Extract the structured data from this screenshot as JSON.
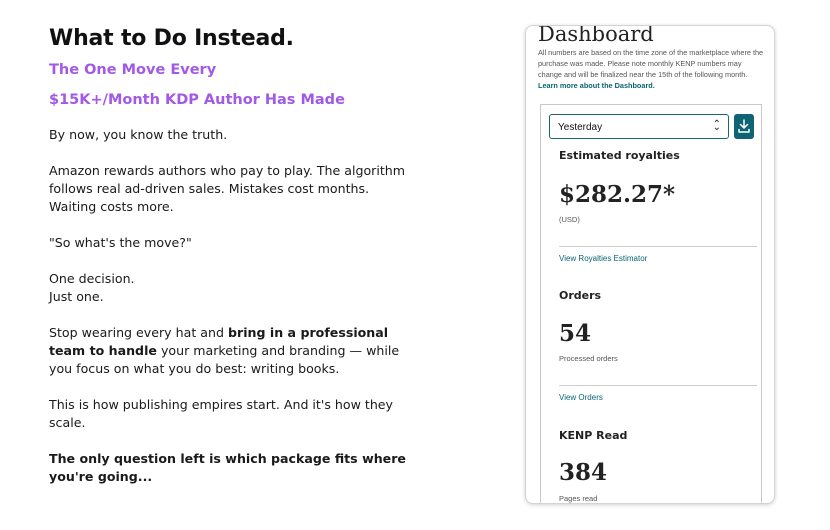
{
  "headline": "What to Do Instead.",
  "subheadline": {
    "line1": "The One Move Every",
    "line2": "$15K+/Month KDP Author Has Made"
  },
  "body": {
    "p1": "By now, you know the truth.",
    "p2": "Amazon rewards authors who pay to play. The algorithm follows real ad-driven sales. Mistakes cost months. Waiting costs more.",
    "p3": "\"So what's the move?\"",
    "p4_line1": "One decision.",
    "p4_line2": "Just one.",
    "p5_pre": "Stop wearing every hat and ",
    "p5_bold": "bring in a professional team to handle",
    "p5_post": " your marketing and branding — while you focus on what you do best: writing books.",
    "p6": "This is how publishing empires start. And it's how they scale.",
    "p7": "The only question left is which package fits where you're going..."
  },
  "dashboard": {
    "title": "Dashboard",
    "note": "All numbers are based on the time zone of the marketplace where the purchase was made. Please note monthly KENP numbers may change and will be finalized near the 15th of the following month.",
    "note_link": "Learn more about the Dashboard.",
    "period_select": "Yesterday",
    "royalties": {
      "title": "Estimated royalties",
      "value": "$282.27*",
      "unit": "(USD)",
      "link": "View Royalties Estimator"
    },
    "orders": {
      "title": "Orders",
      "value": "54",
      "caption": "Processed orders",
      "link": "View Orders"
    },
    "kenp": {
      "title": "KENP Read",
      "value": "384",
      "caption": "Pages read"
    },
    "accent_color": "#0f6474"
  },
  "colors": {
    "subheadline": "#a259e6"
  }
}
